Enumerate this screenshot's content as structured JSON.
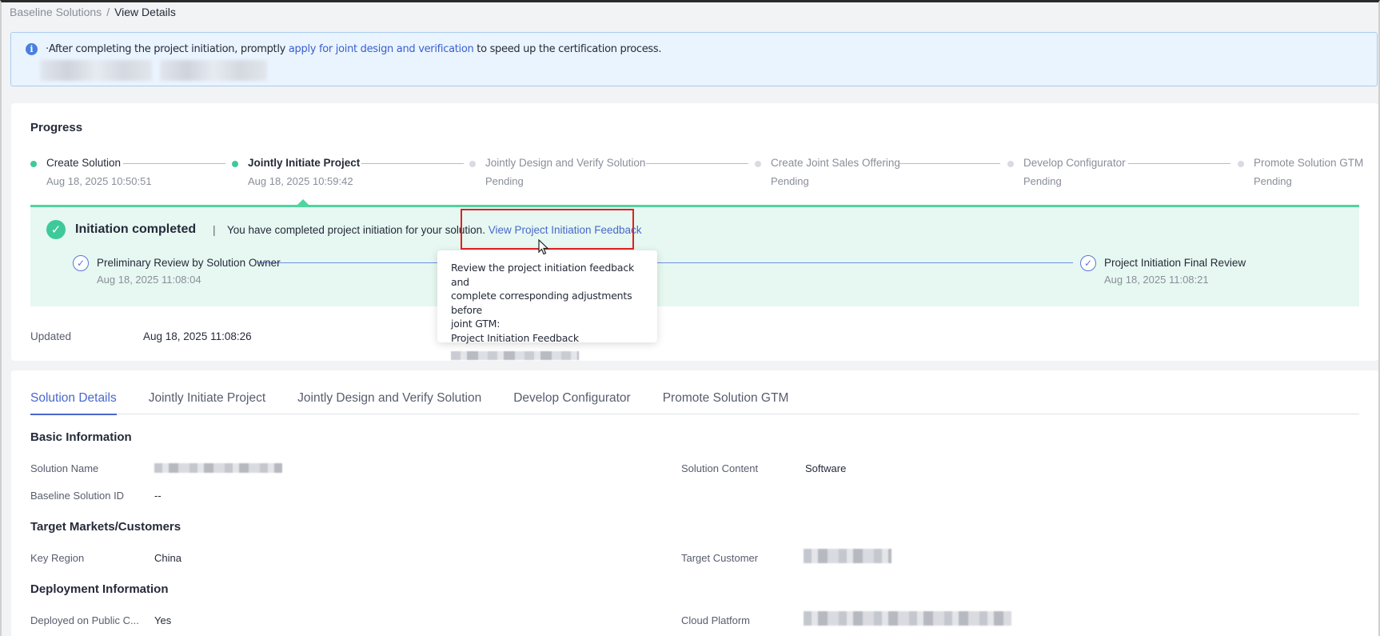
{
  "breadcrumb": {
    "parent": "Baseline Solutions",
    "separator": "/",
    "current": "View Details"
  },
  "notice": {
    "prefix": "·After completing the project initiation, promptly ",
    "link": "apply for joint design and verification",
    "suffix": " to speed up the certification process."
  },
  "progress": {
    "title": "Progress",
    "steps": [
      {
        "title": "Create Solution",
        "sub": "Aug 18, 2025 10:50:51",
        "state": "done"
      },
      {
        "title": "Jointly Initiate Project",
        "sub": "Aug 18, 2025 10:59:42",
        "state": "active"
      },
      {
        "title": "Jointly Design and Verify Solution",
        "sub": "Pending",
        "state": "todo"
      },
      {
        "title": "Create Joint Sales Offering",
        "sub": "Pending",
        "state": "todo"
      },
      {
        "title": "Develop Configurator",
        "sub": "Pending",
        "state": "todo"
      },
      {
        "title": "Promote Solution GTM",
        "sub": "Pending",
        "state": "todo"
      }
    ],
    "status": {
      "title": "Initiation completed",
      "divider": "|",
      "text": "You have completed project initiation for your solution. ",
      "link": "View Project Initiation Feedback"
    },
    "reviews": [
      {
        "title": "Preliminary Review by Solution Owner",
        "date": "Aug 18, 2025 11:08:04"
      },
      {
        "title": "Project Initiation Final Review",
        "date": "Aug 18, 2025 11:08:21"
      }
    ],
    "updated_label": "Updated",
    "updated_value": "Aug 18, 2025 11:08:26"
  },
  "tooltip": {
    "line1": "Review the project initiation feedback and",
    "line2": "complete corresponding adjustments before",
    "line3": "joint GTM:",
    "line4": "Project Initiation Feedback"
  },
  "tabs": [
    {
      "label": "Solution Details",
      "active": true
    },
    {
      "label": "Jointly Initiate Project",
      "active": false
    },
    {
      "label": "Jointly Design and Verify Solution",
      "active": false
    },
    {
      "label": "Develop Configurator",
      "active": false
    },
    {
      "label": "Promote Solution GTM",
      "active": false
    }
  ],
  "basic_info": {
    "title": "Basic Information",
    "solution_name_label": "Solution Name",
    "solution_id_label": "Baseline Solution ID",
    "solution_id_value": "--",
    "solution_content_label": "Solution Content",
    "solution_content_value": "Software"
  },
  "target_markets": {
    "title": "Target Markets/Customers",
    "key_region_label": "Key Region",
    "key_region_value": "China",
    "target_customer_label": "Target Customer"
  },
  "deployment": {
    "title": "Deployment Information",
    "public_cloud_label": "Deployed on Public C...",
    "public_cloud_value": "Yes",
    "cloud_platform_label": "Cloud Platform"
  },
  "colors": {
    "accent": "#4a66cc",
    "success": "#3ec99a",
    "success_bg": "#e6f8f1",
    "highlight": "#e02020"
  }
}
